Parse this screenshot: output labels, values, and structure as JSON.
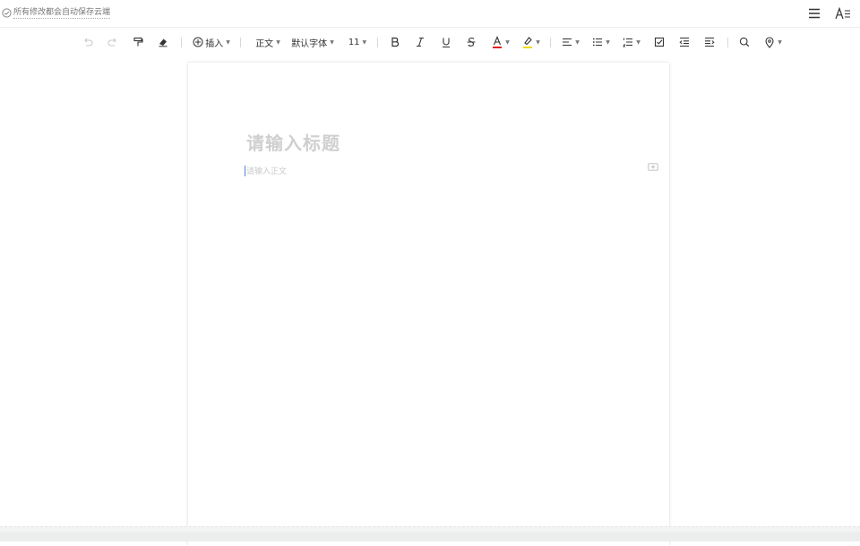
{
  "header": {
    "save_status": "所有修改都会自动保存云端",
    "icons": [
      "check-circle-icon",
      "menu-icon",
      "text-format-icon"
    ]
  },
  "toolbar": {
    "insert_label": "插入",
    "style_label": "正文",
    "font_label": "默认字体",
    "size_label": "11",
    "items": [
      "undo-icon",
      "redo-icon",
      "format-painter-icon",
      "clear-format-icon",
      "insert-icon",
      "bold-icon",
      "italic-icon",
      "underline-icon",
      "strikethrough-icon",
      "font-color-icon",
      "highlight-icon",
      "align-icon",
      "bullet-list-icon",
      "numbered-list-icon",
      "checkbox-icon",
      "outdent-icon",
      "indent-icon",
      "search-icon",
      "location-icon"
    ],
    "font_color": "#e02020",
    "highlight_color": "#f5d90a"
  },
  "document": {
    "title_placeholder": "请输入标题",
    "body_placeholder": "请输入正文"
  }
}
